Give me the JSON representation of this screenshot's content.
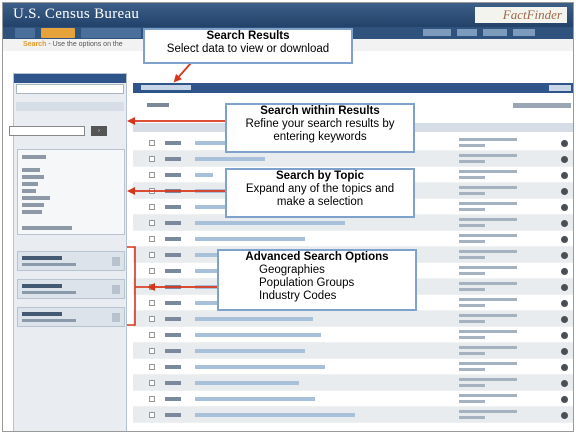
{
  "header": {
    "brand": "U.S. Census Bureau",
    "app_logo": "FactFinder",
    "hint_lead": "Search",
    "hint_text": "- Use the options on the"
  },
  "callouts": {
    "search_results": {
      "title": "Search Results",
      "lines": [
        "Select data to view or download"
      ]
    },
    "search_within": {
      "title": "Search within Results",
      "lines": [
        "Refine your search results by",
        "entering keywords"
      ]
    },
    "search_topic": {
      "title": "Search by Topic",
      "lines": [
        "Expand any of the topics and",
        "make a selection"
      ]
    },
    "advanced": {
      "title": "Advanced Search Options",
      "lines": [
        "Geographies",
        "Population Groups",
        "Industry Codes"
      ]
    }
  },
  "colors": {
    "header": "#2e548a",
    "accent_orange": "#e7a33b",
    "arrow_red": "#d8341c",
    "callout_border": "#7fa2cd"
  }
}
